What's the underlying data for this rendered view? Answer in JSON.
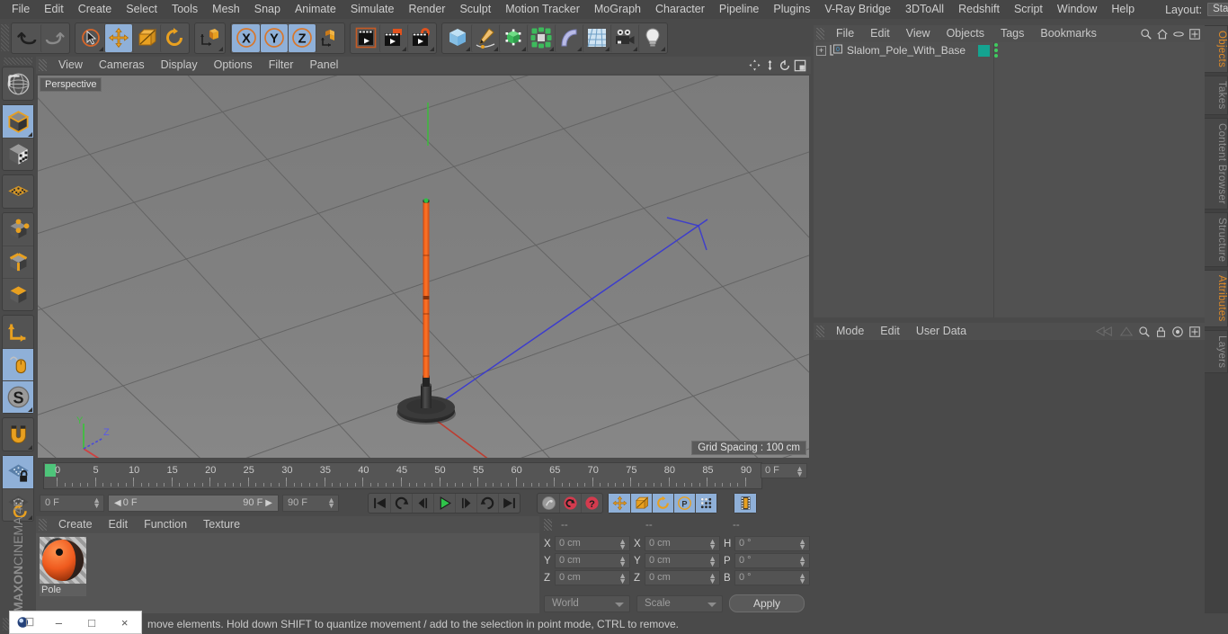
{
  "app": {
    "brand_maxon": "MAXON",
    "brand_c4d": "CINEMA 4D"
  },
  "menubar": {
    "items": [
      "File",
      "Edit",
      "Create",
      "Select",
      "Tools",
      "Mesh",
      "Snap",
      "Animate",
      "Simulate",
      "Render",
      "Sculpt",
      "Motion Tracker",
      "MoGraph",
      "Character",
      "Pipeline",
      "Plugins",
      "V-Ray Bridge",
      "3DToAll",
      "Redshift",
      "Script",
      "Window",
      "Help"
    ],
    "layout_label": "Layout:",
    "layout_value": "Startup",
    "icons": [
      "search-icon",
      "home-icon",
      "minimize-icon",
      "maximize-icon"
    ]
  },
  "toolbar": {
    "groups": [
      {
        "name": "undo-redo",
        "buttons": [
          {
            "icon": "undo-icon",
            "label": "Undo",
            "active": false,
            "corner": false
          },
          {
            "icon": "redo-icon",
            "label": "Redo",
            "active": false,
            "corner": false
          }
        ]
      },
      {
        "name": "selection-transform",
        "buttons": [
          {
            "icon": "live-selection-icon",
            "label": "Live Selection",
            "active": false,
            "corner": true
          },
          {
            "icon": "move-icon",
            "label": "Move",
            "active": true,
            "corner": false
          },
          {
            "icon": "scale-icon",
            "label": "Scale",
            "active": false,
            "corner": false
          },
          {
            "icon": "rotate-icon",
            "label": "Rotate",
            "active": false,
            "corner": false
          }
        ]
      },
      {
        "name": "dynamic-place",
        "buttons": [
          {
            "icon": "dynamic-place-icon",
            "label": "Dynamic Place",
            "active": false,
            "corner": true
          }
        ]
      },
      {
        "name": "axis-locks",
        "buttons": [
          {
            "icon": "x-axis-icon",
            "label": "X Axis",
            "active": true,
            "corner": false
          },
          {
            "icon": "y-axis-icon",
            "label": "Y Axis",
            "active": true,
            "corner": false
          },
          {
            "icon": "z-axis-icon",
            "label": "Z Axis",
            "active": true,
            "corner": false
          },
          {
            "icon": "world-object-axis-icon",
            "label": "World / Object Axis",
            "active": false,
            "corner": false
          }
        ]
      },
      {
        "name": "render",
        "buttons": [
          {
            "icon": "render-view-icon",
            "label": "Render View",
            "active": false,
            "corner": false
          },
          {
            "icon": "render-to-picture-viewer-icon",
            "label": "Render to Picture Viewer",
            "active": false,
            "corner": true
          },
          {
            "icon": "render-settings-icon",
            "label": "Edit Render Settings",
            "active": false,
            "corner": true
          }
        ]
      },
      {
        "name": "create-objects",
        "buttons": [
          {
            "icon": "cube-primitive-icon",
            "label": "Add Cube Object",
            "active": false,
            "corner": true
          },
          {
            "icon": "spline-pen-icon",
            "label": "Spline Pen",
            "active": false,
            "corner": true
          },
          {
            "icon": "subdivision-surface-icon",
            "label": "Subdivision Surface",
            "active": false,
            "corner": true
          },
          {
            "icon": "mograph-cloner-icon",
            "label": "MoGraph Cloner",
            "active": false,
            "corner": true
          },
          {
            "icon": "bend-deformer-icon",
            "label": "Bend Deformer",
            "active": false,
            "corner": true
          },
          {
            "icon": "floor-environment-icon",
            "label": "Floor / Environment",
            "active": false,
            "corner": true
          },
          {
            "icon": "camera-icon",
            "label": "Camera",
            "active": false,
            "corner": true
          },
          {
            "icon": "light-icon",
            "label": "Light",
            "active": false,
            "corner": true
          }
        ]
      }
    ]
  },
  "leftbar": {
    "groups": [
      {
        "buttons": [
          {
            "icon": "texture-axis-icon",
            "label": "Texture Axis",
            "active": false,
            "corner": false
          }
        ]
      },
      {
        "buttons": [
          {
            "icon": "model-mode-icon",
            "label": "Model Mode",
            "active": true,
            "corner": true
          },
          {
            "icon": "texture-mode-icon",
            "label": "Texture Mode",
            "active": false,
            "corner": false
          }
        ]
      },
      {
        "buttons": [
          {
            "icon": "points-grid-icon",
            "label": "Workplane",
            "active": false,
            "corner": false
          }
        ]
      },
      {
        "buttons": [
          {
            "icon": "points-mode-icon",
            "label": "Points Mode",
            "active": false,
            "corner": false
          },
          {
            "icon": "edges-mode-icon",
            "label": "Edges Mode",
            "active": false,
            "corner": false
          },
          {
            "icon": "polygons-mode-icon",
            "label": "Polygons Mode",
            "active": false,
            "corner": false
          }
        ]
      },
      {
        "buttons": [
          {
            "icon": "object-axis-icon",
            "label": "Enable Axis Modification",
            "active": false,
            "corner": false
          },
          {
            "icon": "viewport-solo-icon",
            "label": "Viewport Solo",
            "active": true,
            "corner": false
          },
          {
            "icon": "snap-settings-icon",
            "label": "Enable Snapping",
            "active": true,
            "corner": true
          }
        ]
      },
      {
        "buttons": [
          {
            "icon": "magnet-icon",
            "label": "Magnet",
            "active": false,
            "corner": true
          }
        ]
      },
      {
        "buttons": [
          {
            "icon": "workplane-lock-icon",
            "label": "Lock Workplane",
            "active": true,
            "corner": false
          },
          {
            "icon": "workplane-rotate-icon",
            "label": "Planar Workplane Rotation",
            "active": false,
            "corner": true
          }
        ]
      }
    ]
  },
  "viewport": {
    "menus": [
      "View",
      "Cameras",
      "Display",
      "Options",
      "Filter",
      "Panel"
    ],
    "corner_icons": [
      "pan-icon",
      "dolly-icon",
      "rotate-view-icon",
      "maximize-viewport-icon"
    ],
    "label": "Perspective",
    "grid_spacing": "Grid Spacing : 100 cm",
    "axis_gizmo": {
      "x": "X",
      "y": "Y",
      "z": "Z",
      "x_color": "#d04040",
      "y_color": "#3fbf3f",
      "z_color": "#4a4ad8"
    },
    "scene": {
      "object_name": "Slalom_Pole_With_Base",
      "pole_color": "#f4651a",
      "base_color": "#333333",
      "ground_color": "#7f7f7f"
    }
  },
  "timeline": {
    "ticks": [
      "0",
      "5",
      "10",
      "15",
      "20",
      "25",
      "30",
      "35",
      "40",
      "45",
      "50",
      "55",
      "60",
      "65",
      "70",
      "75",
      "80",
      "85",
      "90"
    ],
    "current_frame_box": "0 F",
    "start_frame": "0 F",
    "preview_min": "0 F",
    "preview_max": "90 F",
    "end_frame": "90 F",
    "buttons": [
      {
        "icon": "go-to-start-icon",
        "label": "Go to Start",
        "active": false
      },
      {
        "icon": "play-backwards-loop-icon",
        "label": "Play Backwards",
        "active": false
      },
      {
        "icon": "previous-frame-icon",
        "label": "Go to Previous Frame",
        "active": false
      },
      {
        "icon": "play-forwards-icon",
        "label": "Play Forwards",
        "active": false
      },
      {
        "icon": "next-frame-icon",
        "label": "Go to Next Frame",
        "active": false
      },
      {
        "icon": "play-loop-icon",
        "label": "Loop",
        "active": false
      },
      {
        "icon": "go-to-end-icon",
        "label": "Go to End",
        "active": false
      },
      {
        "icon": "record-active-objects-icon",
        "label": "Record Active Objects",
        "active": false
      },
      {
        "icon": "autokeying-icon",
        "label": "Autokeying",
        "active": false
      },
      {
        "icon": "keyframe-selection-icon",
        "label": "Keyframe Selection",
        "active": false
      },
      {
        "icon": "position-key-icon",
        "label": "Position",
        "active": true
      },
      {
        "icon": "scale-key-icon",
        "label": "Scale",
        "active": true
      },
      {
        "icon": "rotation-key-icon",
        "label": "Rotation",
        "active": true
      },
      {
        "icon": "parameter-key-icon",
        "label": "Parameter",
        "active": true
      },
      {
        "icon": "point-level-anim-icon",
        "label": "Point Level Animation",
        "active": true
      },
      {
        "icon": "timeline-icon",
        "label": "Timeline",
        "active": true
      }
    ]
  },
  "material_manager": {
    "menus": [
      "Create",
      "Edit",
      "Function",
      "Texture"
    ],
    "materials": [
      {
        "name": "Pole",
        "color": "#ef5a1e"
      }
    ]
  },
  "coordinates": {
    "col_headers": [
      "--",
      "--",
      "--"
    ],
    "rows": [
      {
        "pos_label": "X",
        "pos_value": "0 cm",
        "size_label": "X",
        "size_value": "0 cm",
        "rot_label": "H",
        "rot_value": "0 °"
      },
      {
        "pos_label": "Y",
        "pos_value": "0 cm",
        "size_label": "Y",
        "size_value": "0 cm",
        "rot_label": "P",
        "rot_value": "0 °"
      },
      {
        "pos_label": "Z",
        "pos_value": "0 cm",
        "size_label": "Z",
        "size_value": "0 cm",
        "rot_label": "B",
        "rot_value": "0 °"
      }
    ],
    "coord_system": "World",
    "size_mode": "Scale",
    "apply_label": "Apply"
  },
  "object_manager": {
    "menus": [
      "File",
      "Edit",
      "View",
      "Objects",
      "Tags",
      "Bookmarks"
    ],
    "icons": [
      "search-icon",
      "home-icon",
      "ellipse-icon",
      "plus-box-icon"
    ],
    "objects": [
      {
        "name": "Slalom_Pole_With_Base",
        "layer_badge": "0",
        "tag_color": "#14a390",
        "expandable": true
      }
    ]
  },
  "attribute_manager": {
    "menus": [
      "Mode",
      "Edit",
      "User Data"
    ],
    "icons": [
      "history-back-icon",
      "history-forward-icon",
      "search-icon",
      "lock-icon",
      "target-icon",
      "plus-box-icon"
    ]
  },
  "vertical_tabs": [
    {
      "label": "Objects",
      "selected": true
    },
    {
      "label": "Takes",
      "selected": false
    },
    {
      "label": "Content Browser",
      "selected": false
    },
    {
      "label": "Structure",
      "selected": false
    },
    {
      "label": "Attributes",
      "selected": true
    },
    {
      "label": "Layers",
      "selected": false
    }
  ],
  "statusbar": {
    "message": "move elements. Hold down SHIFT to quantize movement / add to the selection in point mode, CTRL to remove."
  },
  "window_overlay": {
    "icons": [
      "app-icon",
      "restore-icon",
      "minimize-icon",
      "close-icon"
    ],
    "minimize": "–",
    "maximize": "□",
    "close": "×"
  }
}
